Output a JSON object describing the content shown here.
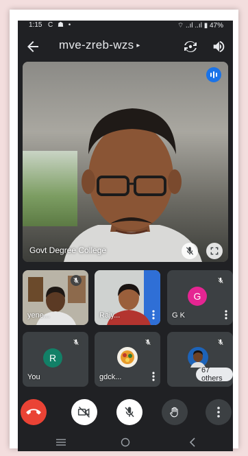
{
  "status": {
    "time": "1:15",
    "notif_icons": "C ☗ •",
    "system_icons": "⌔ ..ıl ..ıl ▮ 47%"
  },
  "call": {
    "meeting_code": "mve-zreb-wzs",
    "caret": "▸"
  },
  "main_tile": {
    "participant_name": "Govt Degree College",
    "speaking_color": "#1a73e8"
  },
  "tiles": [
    {
      "name": "yene...",
      "muted": true,
      "type": "video"
    },
    {
      "name": "Rajy...",
      "muted": false,
      "type": "video"
    },
    {
      "name": "G K",
      "initial": "G",
      "avatar_color": "#e52592",
      "muted": true,
      "type": "avatar"
    },
    {
      "name": "You",
      "initial": "R",
      "avatar_color": "#128067",
      "muted": true,
      "type": "avatar"
    },
    {
      "name": "gdck...",
      "muted": true,
      "type": "photo"
    },
    {
      "name": "67 others",
      "muted": true,
      "type": "others"
    }
  ],
  "controls": {
    "end_call_color": "#ea4335",
    "button_color": "#ffffff",
    "more_color": "#3c4043"
  }
}
